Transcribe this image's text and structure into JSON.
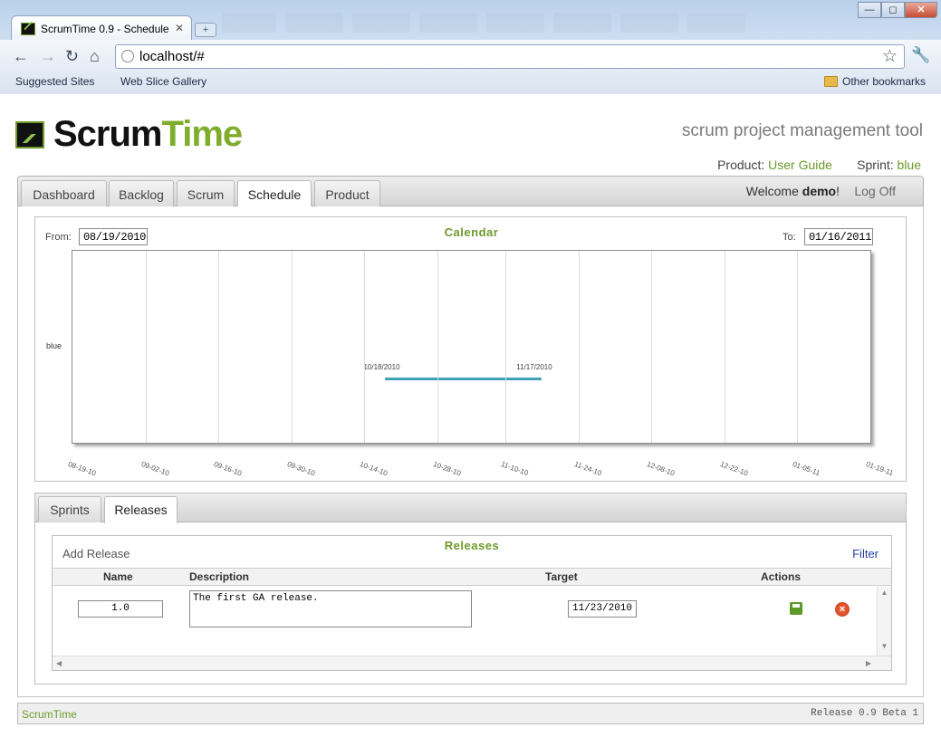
{
  "browser": {
    "tab_title": "ScrumTime 0.9 - Schedule",
    "tab_close": "✕",
    "new_tab": "+",
    "url": "localhost/#",
    "bookmarks": [
      "Suggested Sites",
      "Web Slice Gallery"
    ],
    "other_bookmarks": "Other bookmarks",
    "window_buttons": [
      "—",
      "◻",
      "✕"
    ]
  },
  "header": {
    "logo_scrum": "Scrum",
    "logo_time": "Time",
    "tagline": "scrum project management tool",
    "product_label": "Product:",
    "product_value": "User Guide",
    "sprint_label": "Sprint:",
    "sprint_value": "blue"
  },
  "main_tabs": [
    "Dashboard",
    "Backlog",
    "Scrum",
    "Schedule",
    "Product"
  ],
  "active_main_tab": "Schedule",
  "user": {
    "welcome": "Welcome",
    "name": "demo",
    "suffix": "!",
    "logoff": "Log Off"
  },
  "calendar": {
    "title": "Calendar",
    "from_label": "From:",
    "from_value": "08/19/2010",
    "to_label": "To:",
    "to_value": "01/16/2011",
    "series_label": "blue",
    "bar_start_label": "10/18/2010",
    "bar_end_label": "11/17/2010",
    "x_ticks": [
      "08-19-10",
      "09-02-10",
      "09-16-10",
      "09-30-10",
      "10-14-10",
      "10-28-10",
      "11-10-10",
      "11-24-10",
      "12-08-10",
      "12-22-10",
      "01-05-11",
      "01-19-11"
    ]
  },
  "chart_data": {
    "type": "bar",
    "title": "Calendar",
    "x_range": [
      "08/19/2010",
      "01/19/2011"
    ],
    "categories": [
      "blue"
    ],
    "series": [
      {
        "name": "blue",
        "start": "10/18/2010",
        "end": "11/17/2010"
      }
    ],
    "x_ticks": [
      "08-19-10",
      "09-02-10",
      "09-16-10",
      "09-30-10",
      "10-14-10",
      "10-28-10",
      "11-10-10",
      "11-24-10",
      "12-08-10",
      "12-22-10",
      "01-05-11",
      "01-19-11"
    ],
    "grid": true,
    "bar_color": "#3aa2b3"
  },
  "sub_tabs": [
    "Sprints",
    "Releases"
  ],
  "active_sub_tab": "Releases",
  "releases": {
    "title": "Releases",
    "add_label": "Add Release",
    "filter_label": "Filter",
    "columns": [
      "Name",
      "Description",
      "Target",
      "Actions"
    ],
    "rows": [
      {
        "name": "1.0",
        "description": "The first GA release.",
        "target": "11/23/2010"
      }
    ],
    "delete_glyph": "×"
  },
  "footer": {
    "left": "ScrumTime",
    "right": "Release 0.9 Beta 1"
  },
  "colors": {
    "brand_green": "#6e9a2b",
    "bar_teal": "#3aa2b3",
    "link_blue": "#1f3fa0"
  }
}
